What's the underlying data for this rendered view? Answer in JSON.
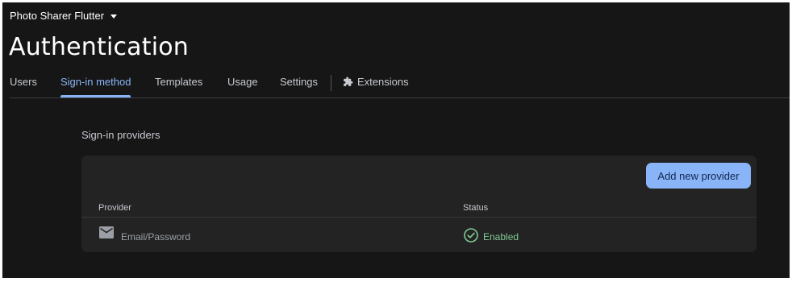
{
  "header": {
    "project_name": "Photo Sharer Flutter",
    "title": "Authentication"
  },
  "tabs": [
    {
      "label": "Users",
      "active": false
    },
    {
      "label": "Sign-in method",
      "active": true
    },
    {
      "label": "Templates",
      "active": false
    },
    {
      "label": "Usage",
      "active": false
    },
    {
      "label": "Settings",
      "active": false
    },
    {
      "label": "Extensions",
      "active": false,
      "icon": "extension-icon"
    }
  ],
  "providers_section": {
    "title": "Sign-in providers",
    "add_button_label": "Add new provider",
    "columns": {
      "provider": "Provider",
      "status": "Status"
    },
    "rows": [
      {
        "provider": "Email/Password",
        "provider_icon": "mail-icon",
        "status": "Enabled",
        "status_icon": "check-circle-icon"
      }
    ]
  },
  "colors": {
    "background": "#161616",
    "card": "#232323",
    "accent": "#8ab4f8",
    "enabled": "#81c995"
  }
}
